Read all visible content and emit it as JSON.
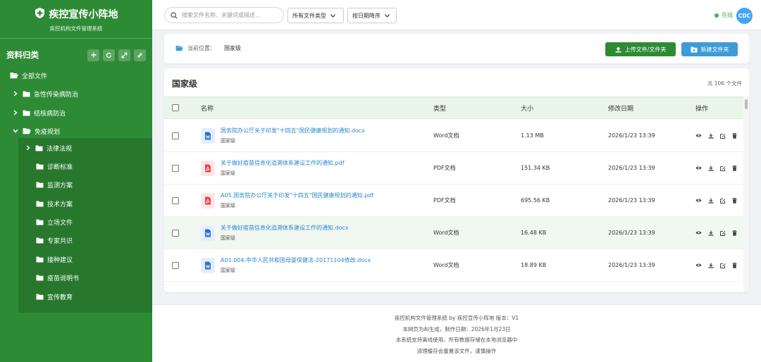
{
  "colors": {
    "brand": "#2e8b35",
    "accent": "#3d9bd6",
    "online": "#4caf50"
  },
  "brand": {
    "title": "疾控宣传小阵地",
    "subtitle": "疾控机构文件管理系统",
    "icon": "shield-plus-icon"
  },
  "sidebar": {
    "section_title": "资料归类",
    "tool_icons": [
      "plus-icon",
      "refresh-icon",
      "expand-icon",
      "collapse-icon"
    ],
    "root": {
      "label": "全部文件",
      "icon": "folder-open-icon"
    },
    "items": [
      {
        "label": "急性传染病防治",
        "expanded": false
      },
      {
        "label": "结核病防治",
        "expanded": false
      },
      {
        "label": "免疫规划",
        "expanded": true
      }
    ],
    "sub_items": [
      {
        "label": "法律法规",
        "has_children": true
      },
      {
        "label": "诊断标准"
      },
      {
        "label": "监测方案"
      },
      {
        "label": "技术方案"
      },
      {
        "label": "立场文件"
      },
      {
        "label": "专家共识"
      },
      {
        "label": "接种建议"
      },
      {
        "label": "疫苗说明书"
      },
      {
        "label": "宣传教育"
      }
    ]
  },
  "topbar": {
    "search_placeholder": "搜索文件名称、关键词或描述...",
    "type_filter": "所有文件类型",
    "sort": "按日期降序",
    "status": "在线",
    "avatar": "CDC"
  },
  "breadcrumb": {
    "prefix": "当前位置：",
    "current": "国家级"
  },
  "actions": {
    "upload": "上传文件/文件夹",
    "new_folder": "新建文件夹"
  },
  "table": {
    "title": "国家级",
    "count": "共 106 个文件",
    "headers": {
      "name": "名称",
      "type": "类型",
      "size": "大小",
      "date": "修改日期",
      "ops": "操作"
    },
    "rows": [
      {
        "name": "国务院办公厅关于印发\"十四五\"国民健康规划的通知.docx",
        "location": "国家级",
        "type": "Word文档",
        "size": "1.13 MB",
        "date": "2026/1/23 13:39",
        "kind": "word"
      },
      {
        "name": "关于做好疫苗信息化追溯体系建设工作的通知.pdf",
        "location": "国家级",
        "type": "PDF文档",
        "size": "151.34 KB",
        "date": "2026/1/23 13:39",
        "kind": "pdf"
      },
      {
        "name": "A05.国务院办公厅关于印发\"十四五\"国民健康规划的通知.pdf",
        "location": "国家级",
        "type": "PDF文档",
        "size": "695.56 KB",
        "date": "2026/1/23 13:39",
        "kind": "pdf"
      },
      {
        "name": "关于做好疫苗信息化追溯体系建设工作的通知.docx",
        "location": "国家级",
        "type": "Word文档",
        "size": "16.48 KB",
        "date": "2026/1/23 13:39",
        "kind": "word"
      },
      {
        "name": "A01.004.中华人民共和国母婴保健法-20171104修改.docx",
        "location": "国家级",
        "type": "Word文档",
        "size": "18.89 KB",
        "date": "2026/1/23 13:39",
        "kind": "word"
      }
    ]
  },
  "footer": {
    "lines": [
      "疾控机构文件管理系统 by 疾控宣传小阵地 版本：V1",
      "本网页为AI生成，制作日期：2026年1月23日",
      "本系统支持离线使用，所有数据存储在本地浏览器中",
      "清理缓存会重置该文件，谨慎操作"
    ]
  }
}
